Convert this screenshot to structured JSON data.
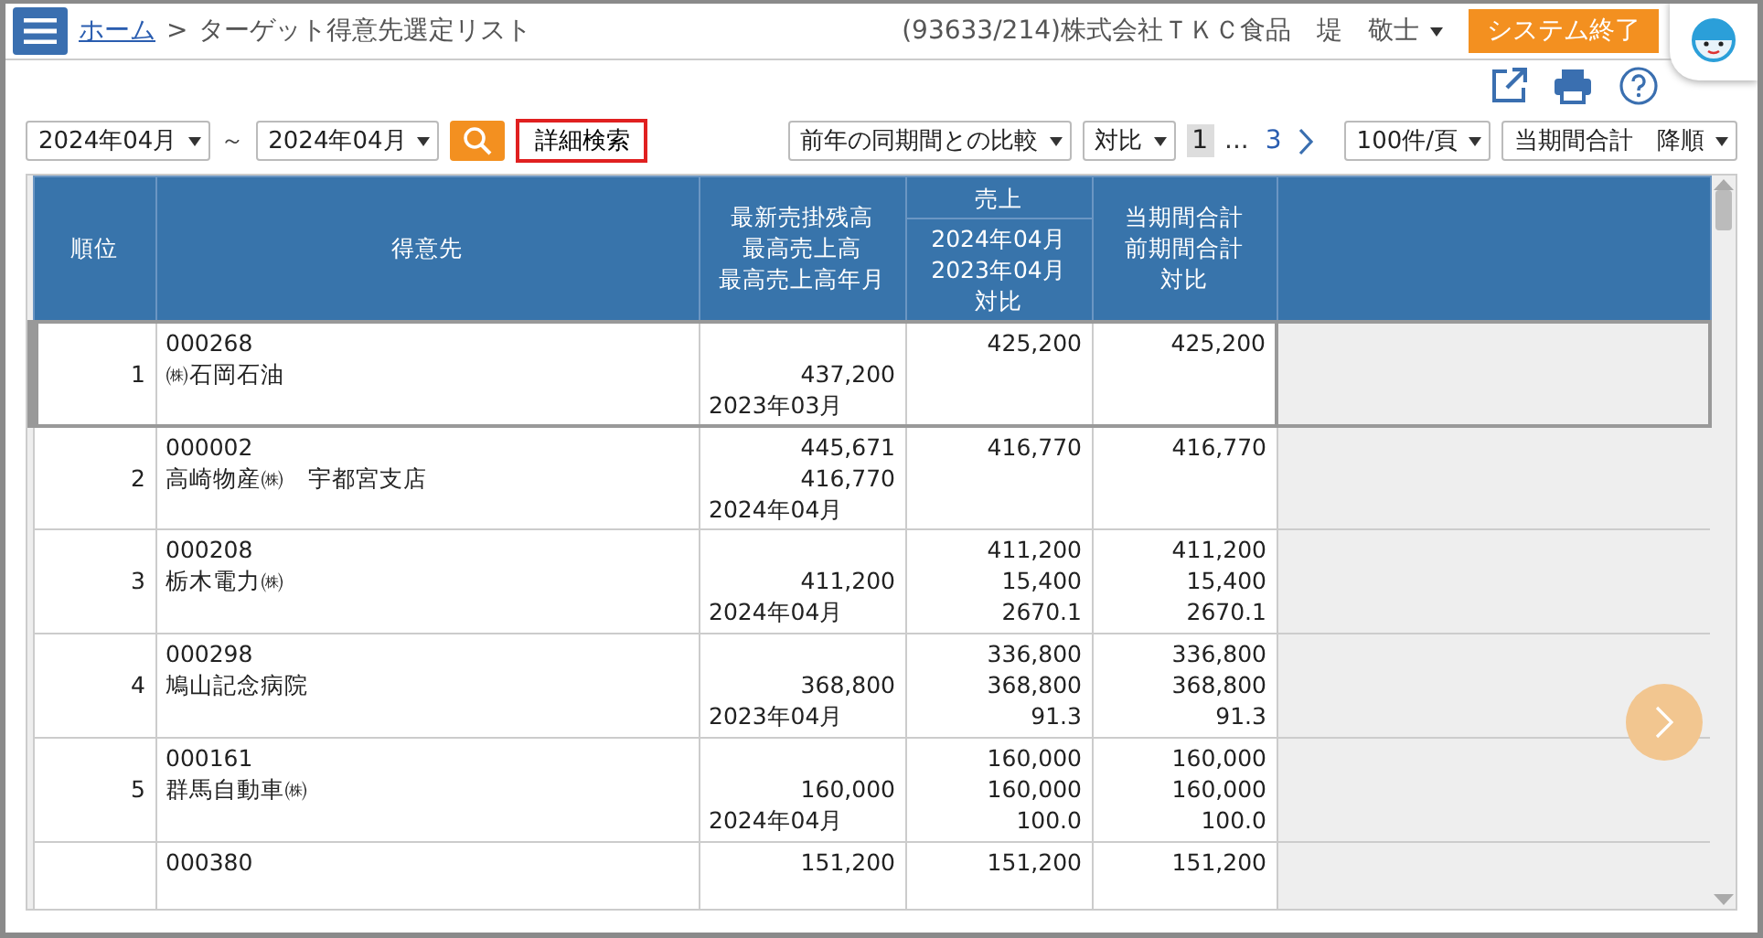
{
  "header": {
    "breadcrumb": [
      {
        "label": "ホーム",
        "kind": "link"
      },
      {
        "label": "ターゲット得意先選定リスト",
        "kind": "current"
      }
    ],
    "separator": ">",
    "user": "(93633/214)株式会社ＴＫＣ食品　堤　敬士",
    "exit_button": "システム終了"
  },
  "toolbar": {
    "period_from": "2024年04月",
    "tilde": "～",
    "period_to": "2024年04月",
    "detail_search": {
      "label": "詳細検索",
      "highlighted": true
    },
    "comparison": "前年の同期間との比較",
    "display": "対比",
    "pages": [
      {
        "label": "1",
        "selected": true
      },
      {
        "label": "3",
        "selected": false
      }
    ],
    "ellipsis": "...",
    "per_page": "100件/頁",
    "sort": "当期間合計　降順"
  },
  "table": {
    "columns": {
      "rank": "順位",
      "customer": "得意先",
      "balance": [
        "最新売掛残高",
        "最高売上高",
        "最高売上高年月"
      ],
      "sales_group": "売上",
      "sales": [
        "2024年04月",
        "2023年04月",
        "対比"
      ],
      "total": [
        "当期間合計",
        "前期間合計",
        "対比"
      ]
    },
    "rows": [
      {
        "rank": "1",
        "code": "000268",
        "name": "㈱石岡石油",
        "max_sales": "437,200",
        "max_month": "2023年03月",
        "sales": [
          "425,200"
        ],
        "total": [
          "425,200"
        ],
        "selected": true
      },
      {
        "rank": "2",
        "code": "000002",
        "name": "高崎物産㈱　宇都宮支店",
        "latest_balance": "445,671",
        "max_sales": "416,770",
        "max_month": "2024年04月",
        "sales": [
          "416,770"
        ],
        "total": [
          "416,770"
        ],
        "selected": false
      },
      {
        "rank": "3",
        "code": "000208",
        "name": "栃木電力㈱",
        "max_sales": "411,200",
        "max_month": "2024年04月",
        "sales": [
          "411,200",
          "15,400",
          "2670.1"
        ],
        "total": [
          "411,200",
          "15,400",
          "2670.1"
        ],
        "selected": false
      },
      {
        "rank": "4",
        "code": "000298",
        "name": "鳩山記念病院",
        "max_sales": "368,800",
        "max_month": "2023年04月",
        "sales": [
          "336,800",
          "368,800",
          "91.3"
        ],
        "total": [
          "336,800",
          "368,800",
          "91.3"
        ],
        "selected": false
      },
      {
        "rank": "5",
        "code": "000161",
        "name": "群馬自動車㈱",
        "max_sales": "160,000",
        "max_month": "2024年04月",
        "sales": [
          "160,000",
          "160,000",
          "100.0"
        ],
        "total": [
          "160,000",
          "160,000",
          "100.0"
        ],
        "selected": false
      },
      {
        "code": "000380",
        "latest_balance": "151,200",
        "sales": [
          "151,200"
        ],
        "total": [
          "151,200"
        ],
        "selected": false
      }
    ]
  }
}
